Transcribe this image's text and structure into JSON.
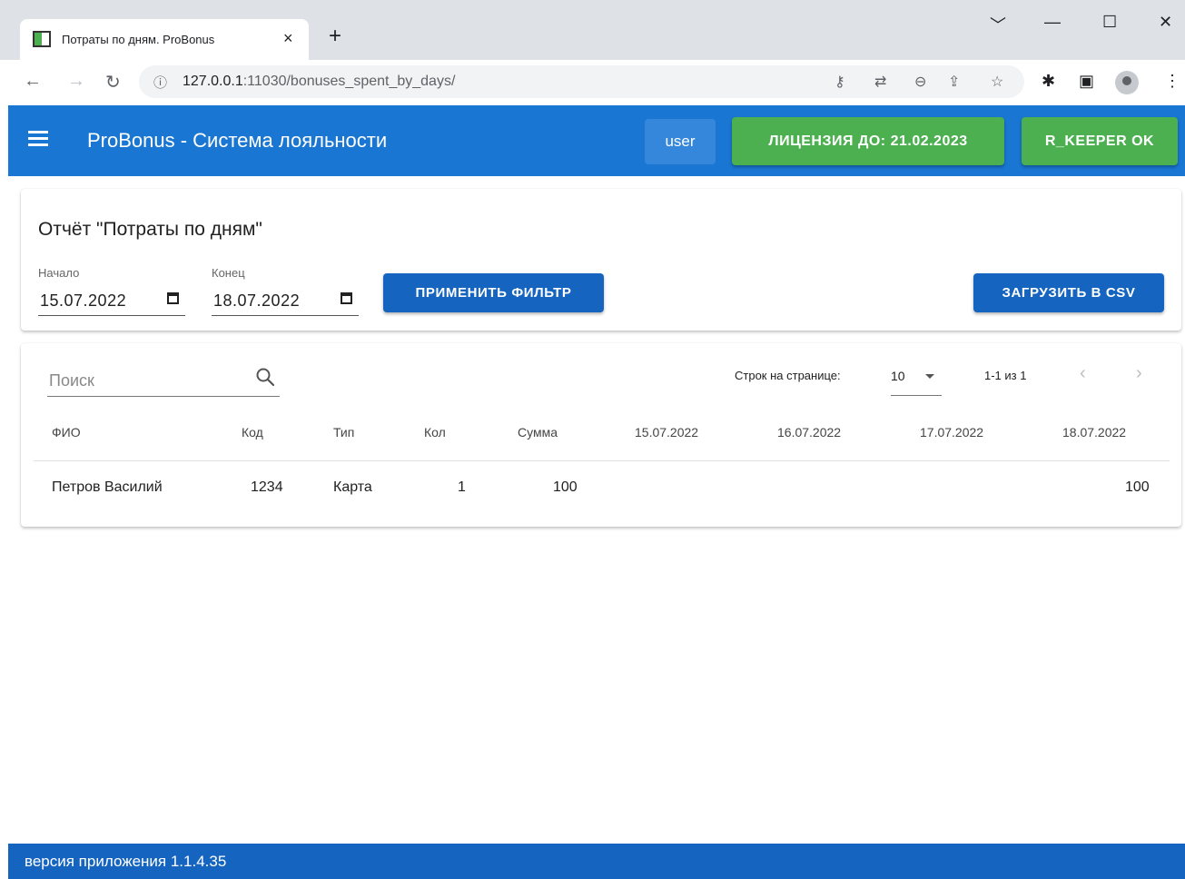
{
  "browser": {
    "tab_title": "Потраты по дням. ProBonus",
    "tab_close": "×",
    "new_tab": "+",
    "url_host": "127.0.0.1",
    "url_rest": ":11030/bonuses_spent_by_days/",
    "window_controls": [
      "﹀",
      "—",
      "☐",
      "✕"
    ]
  },
  "appbar": {
    "title": "ProBonus - Система лояльности",
    "user": "user",
    "license": "ЛИЦЕНЗИЯ ДО: 21.02.2023",
    "rkeeper": "R_KEEPER OK",
    "colors": {
      "primary": "#1976d2",
      "success": "#4caf50"
    }
  },
  "report": {
    "title": "Отчёт \"Потраты по дням\"",
    "start_label": "Начало",
    "start_value": "15.07.2022",
    "end_label": "Конец",
    "end_value": "18.07.2022",
    "apply_button": "ПРИМЕНИТЬ ФИЛЬТР",
    "csv_button": "ЗАГРУЗИТЬ В CSV"
  },
  "table": {
    "search_placeholder": "Поиск",
    "rows_per_page_label": "Строк на странице:",
    "rows_per_page": "10",
    "range": "1-1 из 1",
    "prev": "‹",
    "next": "›",
    "columns": [
      "ФИО",
      "Код",
      "Тип",
      "Кол",
      "Сумма",
      "15.07.2022",
      "16.07.2022",
      "17.07.2022",
      "18.07.2022"
    ],
    "rows": [
      {
        "fio": "Петров Василий",
        "code": "1234",
        "type": "Карта",
        "count": "1",
        "sum": "100",
        "d1": "",
        "d2": "",
        "d3": "",
        "d4": "100"
      }
    ]
  },
  "footer": {
    "version": "версия приложения 1.1.4.35"
  }
}
